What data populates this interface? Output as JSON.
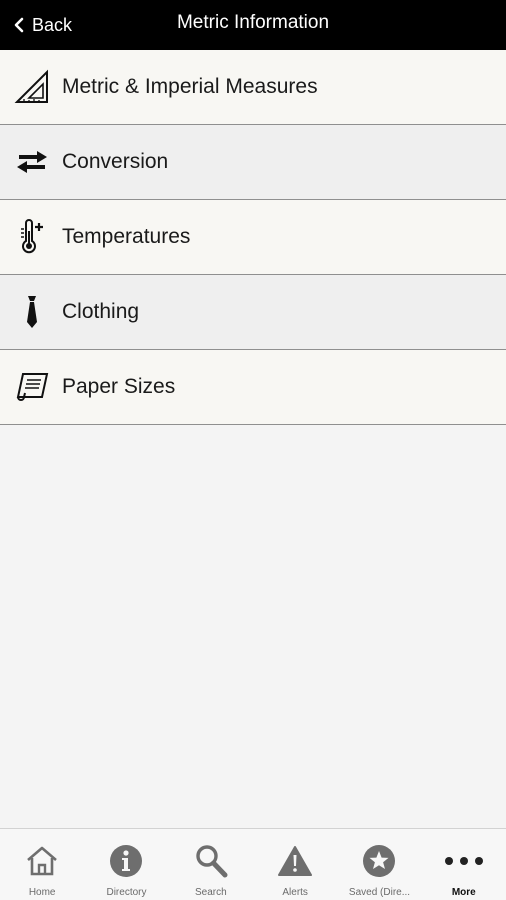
{
  "header": {
    "back_label": "Back",
    "title": "Metric Information"
  },
  "list": {
    "items": [
      {
        "label": "Metric & Imperial Measures",
        "icon": "set-square-ruler-icon"
      },
      {
        "label": "Conversion",
        "icon": "swap-arrows-icon"
      },
      {
        "label": "Temperatures",
        "icon": "thermometer-icon"
      },
      {
        "label": "Clothing",
        "icon": "necktie-icon"
      },
      {
        "label": "Paper Sizes",
        "icon": "paper-scroll-icon"
      }
    ]
  },
  "tabbar": {
    "tabs": [
      {
        "label": "Home",
        "icon": "house-icon"
      },
      {
        "label": "Directory",
        "icon": "info-icon"
      },
      {
        "label": "Search",
        "icon": "magnifier-icon"
      },
      {
        "label": "Alerts",
        "icon": "warning-icon"
      },
      {
        "label": "Saved (Dire...",
        "icon": "star-icon"
      },
      {
        "label": "More",
        "icon": "more-dots-icon",
        "active": true
      }
    ]
  }
}
